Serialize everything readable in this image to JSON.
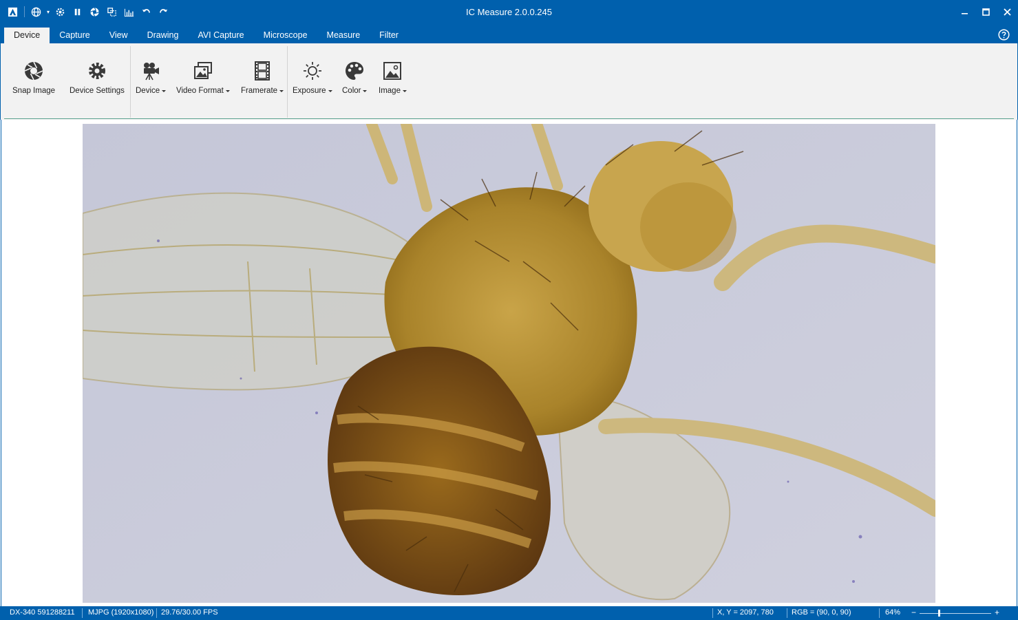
{
  "app": {
    "title": "IC Measure 2.0.0.245"
  },
  "quick_access": [
    {
      "icon": "app-logo-icon"
    },
    {
      "icon": "globe-icon"
    },
    {
      "icon": "gear-icon"
    },
    {
      "icon": "pause-icon"
    },
    {
      "icon": "snap-icon"
    },
    {
      "icon": "crop-icon"
    },
    {
      "icon": "histogram-icon"
    },
    {
      "icon": "undo-icon"
    },
    {
      "icon": "redo-icon"
    }
  ],
  "tabs": [
    {
      "label": "Device",
      "active": true
    },
    {
      "label": "Capture"
    },
    {
      "label": "View"
    },
    {
      "label": "Drawing"
    },
    {
      "label": "AVI Capture"
    },
    {
      "label": "Microscope"
    },
    {
      "label": "Measure"
    },
    {
      "label": "Filter"
    }
  ],
  "ribbon": {
    "snap_image": "Snap Image",
    "device_settings": "Device Settings",
    "device": "Device",
    "video_format": "Video Format",
    "framerate": "Framerate",
    "exposure": "Exposure",
    "color": "Color",
    "image": "Image"
  },
  "status": {
    "camera": "DX-340  591288211",
    "format": "MJPG (1920x1080)",
    "fps": "29.76/30.00 FPS",
    "coords": "X, Y = 2097, 780",
    "rgb": "RGB = (90, 0, 90)",
    "zoom": "64%",
    "zoom_minus": "−",
    "zoom_plus": "+"
  },
  "colors": {
    "brand_blue": "#0060ad",
    "ribbon_bg": "#f2f2f2",
    "image_bg": "#c7c9d9",
    "specimen": "#b5932f"
  },
  "zoom_level": 0.64
}
